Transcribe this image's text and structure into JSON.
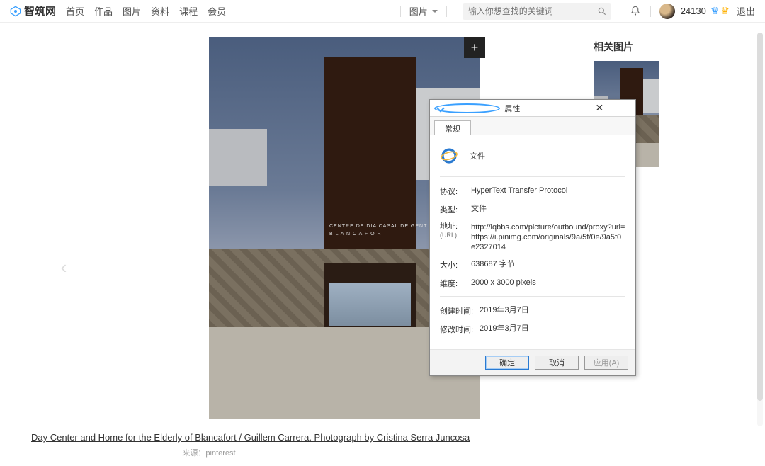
{
  "header": {
    "site": "智筑网",
    "nav": [
      "首页",
      "作品",
      "图片",
      "资料",
      "课程",
      "会员"
    ],
    "dropdown": "图片",
    "search_placeholder": "输入你想查找的关键词",
    "points": "24130",
    "logout": "退出"
  },
  "image": {
    "sign_line1": "CENTRE DE DIA   CASAL DE GENT GRAN",
    "sign_line2": "B L A N C A F O R T",
    "caption": "Day Center and Home for the Elderly of Blancafort / Guillem Carrera. Photograph by Cristina Serra Juncosa",
    "source_label": "来源：",
    "source_value": "pinterest"
  },
  "side": {
    "title": "相关图片"
  },
  "dialog": {
    "title": "属性",
    "tab": "常规",
    "file_label": "文件",
    "rows": {
      "protocol_k": "协议:",
      "protocol_v": "HyperText Transfer Protocol",
      "type_k": "类型:",
      "type_v": "文件",
      "url_k": "地址:",
      "url_sub": "(URL)",
      "url_v": "http://iqbbs.com/picture/outbound/proxy?url=https://i.pinimg.com/originals/9a/5f/0e/9a5f0e2327014",
      "size_k": "大小:",
      "size_v": "638687 字节",
      "dim_k": "维度:",
      "dim_v": "2000 x 3000 pixels",
      "created_k": "创建时间:",
      "created_v": "2019年3月7日",
      "modified_k": "修改时间:",
      "modified_v": "2019年3月7日"
    },
    "ok": "确定",
    "cancel": "取消",
    "apply": "应用(A)"
  }
}
